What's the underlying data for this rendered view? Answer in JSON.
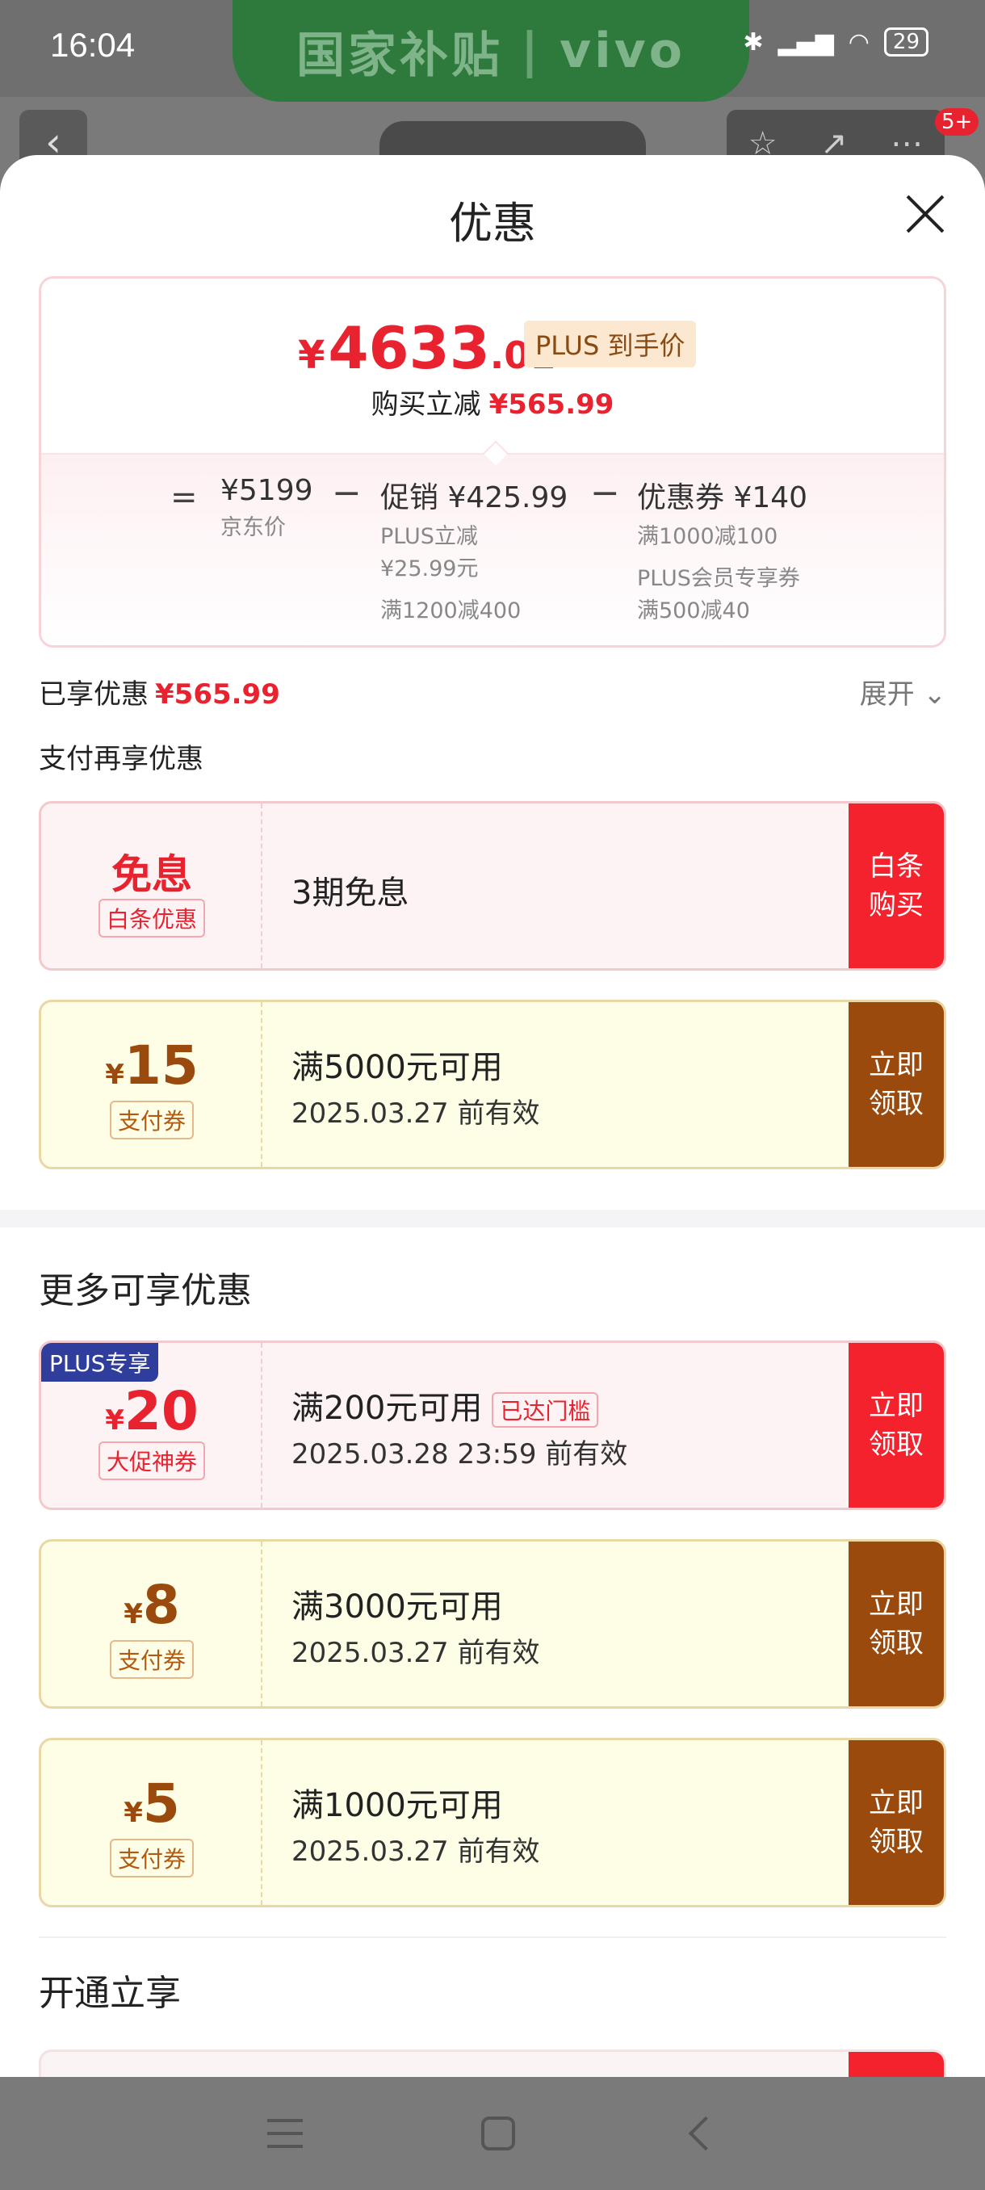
{
  "status": {
    "time": "16:04",
    "brand_left": "国家补贴",
    "brand_right": "vivo",
    "battery": "29",
    "badge": "5+"
  },
  "sheet": {
    "title": "优惠"
  },
  "price": {
    "currency": "¥",
    "final_int": "4633",
    "final_dec": ".01",
    "plus_tag": "PLUS 到手价",
    "reduce_label": "购买立减",
    "reduce_amount": "¥565.99",
    "eq": "=",
    "minus": "−",
    "jd_price": "¥5199",
    "jd_label": "京东价",
    "promo_main": "促销 ¥425.99",
    "promo_sub1": "PLUS立减",
    "promo_sub2": "¥25.99元",
    "promo_sub3": "满1200减400",
    "coupon_main": "优惠券 ¥140",
    "coupon_sub1": "满1000减100",
    "coupon_sub2": "PLUS会员专享券",
    "coupon_sub3": "满500减40"
  },
  "enjoyed": {
    "label": "已享优惠",
    "amount": "¥565.99",
    "expand": "展开"
  },
  "pay_section": {
    "title": "支付再享优惠"
  },
  "coupons_pay": [
    {
      "big": "免息",
      "kind": "白条优惠",
      "cond": "3期免息",
      "action1": "白条",
      "action2": "购买"
    },
    {
      "currency": "¥",
      "amount": "15",
      "kind": "支付券",
      "cond": "满5000元可用",
      "valid": "2025.03.27 前有效",
      "action1": "立即",
      "action2": "领取"
    }
  ],
  "more_section": {
    "title": "更多可享优惠"
  },
  "coupons_more": [
    {
      "plus": "PLUS专享",
      "currency": "¥",
      "amount": "20",
      "kind": "大促神券",
      "cond": "满200元可用",
      "reached": "已达门槛",
      "valid": "2025.03.28 23:59 前有效",
      "action1": "立即",
      "action2": "领取"
    },
    {
      "currency": "¥",
      "amount": "8",
      "kind": "支付券",
      "cond": "满3000元可用",
      "valid": "2025.03.27 前有效",
      "action1": "立即",
      "action2": "领取"
    },
    {
      "currency": "¥",
      "amount": "5",
      "kind": "支付券",
      "cond": "满1000元可用",
      "valid": "2025.03.27 前有效",
      "action1": "立即",
      "action2": "领取"
    }
  ],
  "open_section": {
    "title": "开通立享"
  },
  "colors": {
    "red": "#e8232f",
    "brown": "#9a4a0c",
    "plus_blue": "#2f3e9c"
  }
}
